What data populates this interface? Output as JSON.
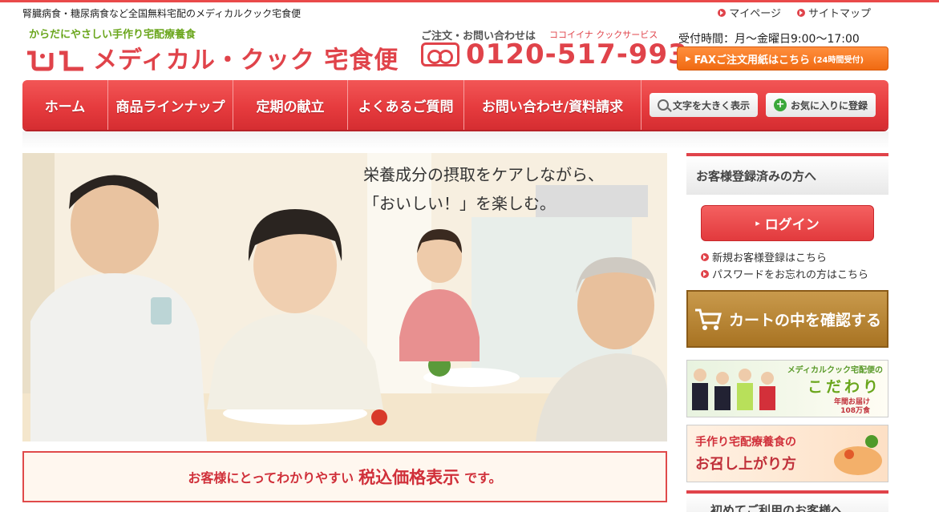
{
  "header": {
    "tagline": "腎臓病食・糖尿病食など全国無料宅配のメディカルクック宅食便",
    "top_links": [
      "マイページ",
      "サイトマップ"
    ],
    "subtitle": "からだにやさしい手作り宅配療養食",
    "logo_text": "メディカル・クック 宅食便",
    "contact_label": "ご注文・お問い合わせは",
    "contact_company": "ココイイナ クックサービス",
    "phone": "0120-517-993",
    "hours": "受付時間：月～金曜日9:00～17:00",
    "fax_label": "FAXご注文用紙はこちら",
    "fax_note": "(24時間受付)"
  },
  "nav": {
    "items": [
      "ホーム",
      "商品ラインナップ",
      "定期の献立",
      "よくあるご質問",
      "お問い合わせ/資料請求"
    ],
    "text_size_button": "文字を大きく表示",
    "favorite_button": "お気に入りに登録"
  },
  "hero": {
    "line1": "栄養成分の摂取をケアしながら、",
    "line2": "「おいしい！」を楽しむ。"
  },
  "notice": {
    "prefix": "お客様にとってわかりやすい",
    "emphasis": "税込価格表示",
    "suffix": "です。"
  },
  "sidebar": {
    "registered_heading": "お客様登録済みの方へ",
    "login_button": "ログイン",
    "links": [
      "新規お客様登録はこちら",
      "パスワードをお忘れの方はこちら"
    ],
    "cart_button": "カートの中を確認する",
    "banner1_small": "メディカルクック宅配便の",
    "banner1_title": "こだわり",
    "banner1_note1": "年間お届け",
    "banner1_note2": "108万食",
    "banner2_line1": "手作り宅配療養食の",
    "banner2_line2": "お召し上がり方",
    "banner3_label": "初めてご利用のお客様へ"
  }
}
